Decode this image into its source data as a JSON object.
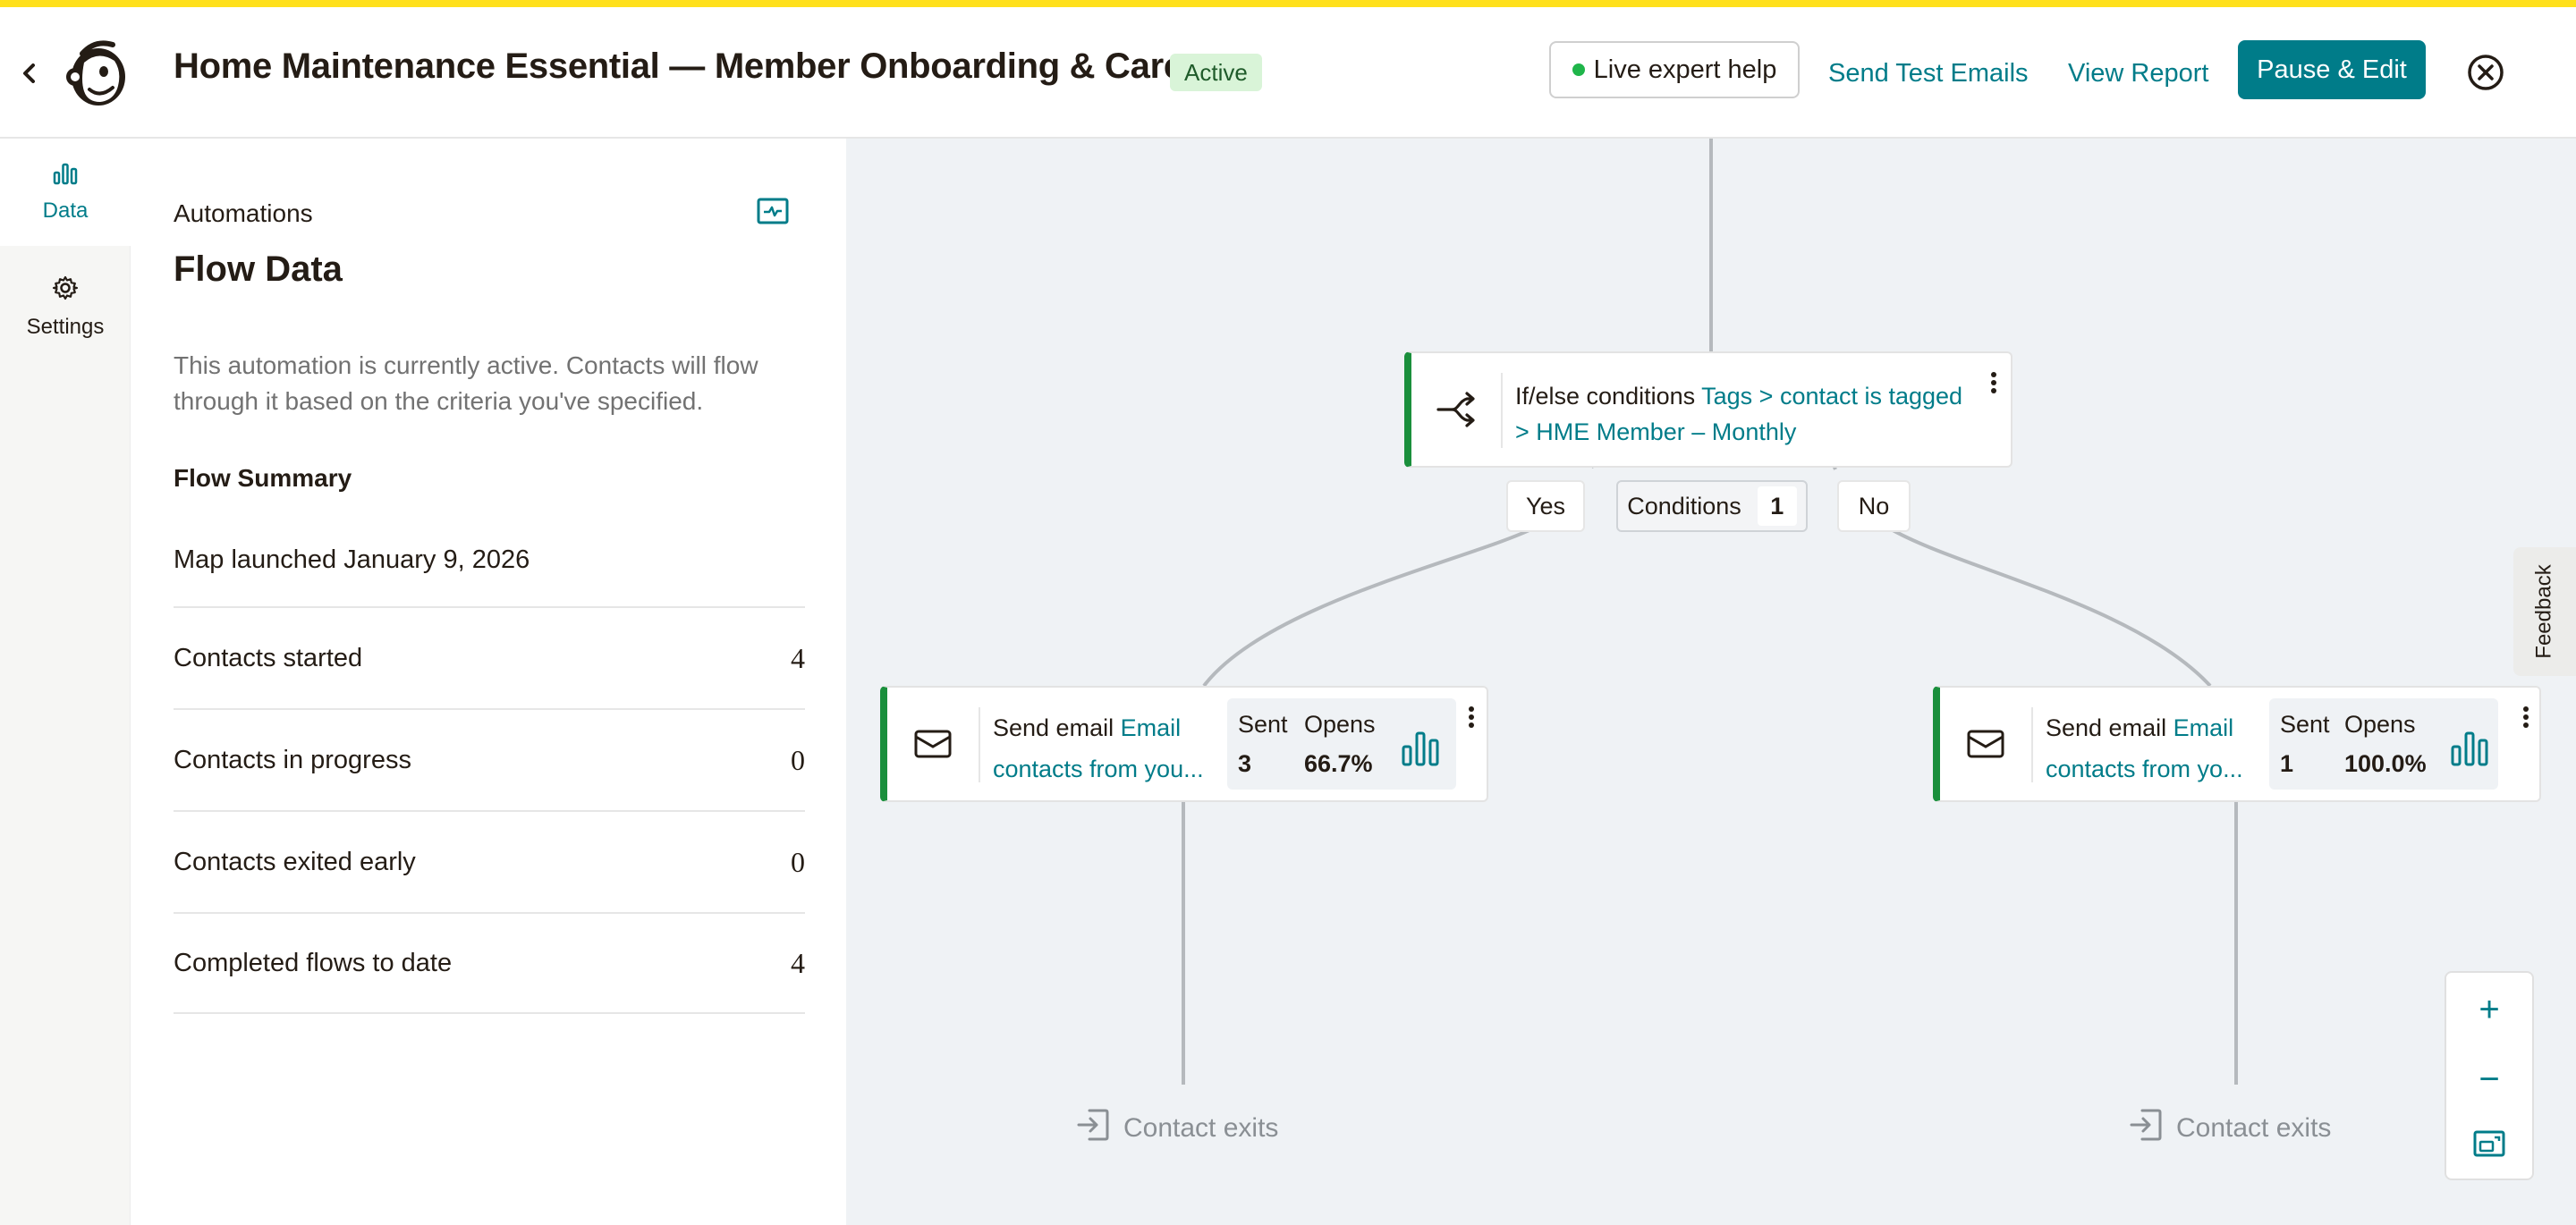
{
  "header": {
    "title": "Home Maintenance Essential — Member Onboarding & Care",
    "status_badge": "Active",
    "live_help_label": "Live expert help",
    "send_test_label": "Send Test Emails",
    "view_report_label": "View Report",
    "pause_edit_label": "Pause & Edit",
    "icons": {
      "back": "chevron-left-icon",
      "logo": "mailchimp-freddie-logo",
      "close": "close-circle-icon"
    }
  },
  "rail": {
    "items": [
      {
        "label": "Data",
        "icon": "bar-chart-icon",
        "active": true
      },
      {
        "label": "Settings",
        "icon": "gear-icon",
        "active": false
      }
    ]
  },
  "panel": {
    "section": "Automations",
    "title": "Flow Data",
    "description": "This automation is currently active. Contacts will flow through it based on the criteria you've specified.",
    "summary_heading": "Flow Summary",
    "launched": "Map launched January 9, 2026",
    "rows": [
      {
        "label": "Contacts started",
        "value": "4"
      },
      {
        "label": "Contacts in progress",
        "value": "0"
      },
      {
        "label": "Contacts exited early",
        "value": "0"
      },
      {
        "label": "Completed flows to date",
        "value": "4"
      }
    ]
  },
  "canvas": {
    "condition_node": {
      "label": "If/else conditions",
      "detail": "Tags > contact is tagged > HME Member – Monthly"
    },
    "branches": {
      "yes": "Yes",
      "no": "No",
      "conditions_label": "Conditions",
      "conditions_count": "1"
    },
    "email_left": {
      "label": "Send email",
      "link_l1": "Email",
      "link_l2": "contacts from you...",
      "sent_label": "Sent",
      "sent": "3",
      "opens_label": "Opens",
      "opens": "66.7%"
    },
    "email_right": {
      "label": "Send email",
      "link_l1": "Email",
      "link_l2": "contacts from yo...",
      "sent_label": "Sent",
      "sent": "1",
      "opens_label": "Opens",
      "opens": "100.0%"
    },
    "exit_left": "Contact exits",
    "exit_right": "Contact exits"
  },
  "feedback_label": "Feedback",
  "zoom": {
    "in": "+",
    "out": "−"
  },
  "colors": {
    "accent": "#007c89",
    "active_border": "#1a8f3c",
    "top_bar": "#ffe01b",
    "canvas_bg": "#eff2f5"
  }
}
